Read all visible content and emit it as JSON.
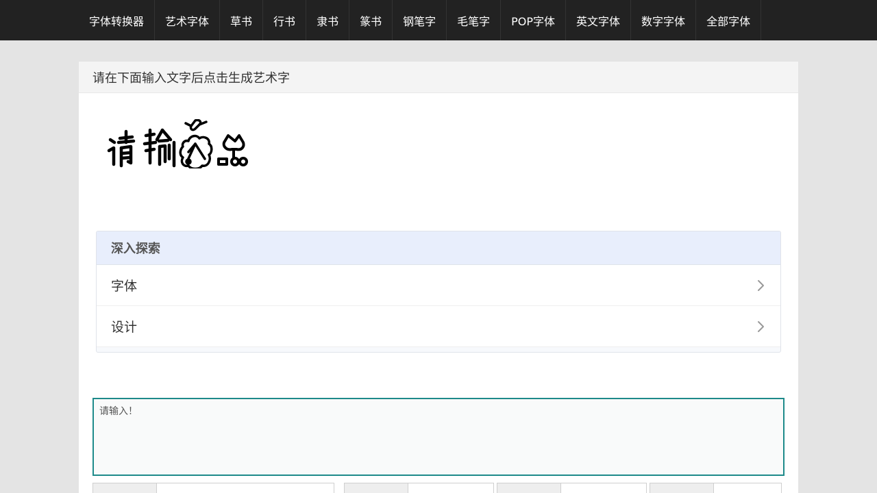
{
  "nav": {
    "items": [
      {
        "label": "字体转换器"
      },
      {
        "label": "艺术字体"
      },
      {
        "label": "草书"
      },
      {
        "label": "行书"
      },
      {
        "label": "隶书"
      },
      {
        "label": "篆书"
      },
      {
        "label": "钢笔字"
      },
      {
        "label": "毛笔字"
      },
      {
        "label": "POP字体"
      },
      {
        "label": "英文字体"
      },
      {
        "label": "数字字体"
      },
      {
        "label": "全部字体"
      }
    ]
  },
  "panel": {
    "title": "请在下面输入文字后点击生成艺术字"
  },
  "preview": {
    "text": "请输入"
  },
  "explore": {
    "title": "深入探索",
    "items": [
      {
        "label": "字体"
      },
      {
        "label": "设计"
      }
    ]
  },
  "input": {
    "placeholder": "请输入！"
  },
  "colors": {
    "nav_bg": "#222222",
    "accent": "#1d8a8a",
    "explore_header": "#e8eefc"
  }
}
